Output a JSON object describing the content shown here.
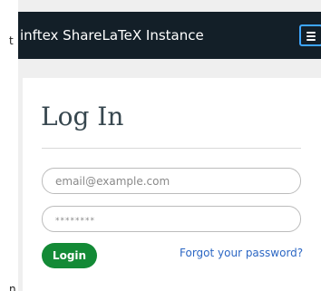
{
  "page_edge": {
    "top_fragment": "t",
    "bottom_fragment": "n"
  },
  "navbar": {
    "brand": "inftex ShareLaTeX Instance",
    "menu_icon": "hamburger-menu-icon"
  },
  "login": {
    "title": "Log In",
    "email_placeholder": "email@example.com",
    "password_placeholder": "********",
    "login_button": "Login",
    "forgot_link": "Forgot your password?"
  },
  "colors": {
    "navbar_bg": "#131f28",
    "toggle_border": "#3ea6ff",
    "login_button_bg": "#138a36",
    "link": "#2c67c4",
    "page_bg": "#efefef"
  }
}
